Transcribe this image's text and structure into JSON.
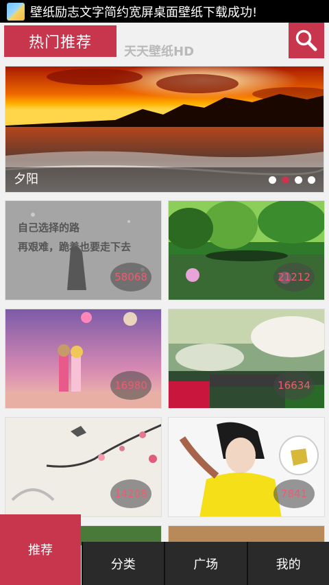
{
  "status_bar": {
    "notification": "壁纸励志文字简约宽屏桌面壁纸下载成功!"
  },
  "header": {
    "tab_label": "热门推荐",
    "app_title": "天天壁纸HD",
    "search_icon": "search-icon"
  },
  "banner": {
    "caption": "夕阳",
    "slides": 4,
    "active_slide": 2
  },
  "tiles": [
    {
      "count": "58068",
      "overlay_line1": "自己选择的路",
      "overlay_line2": "再艰难，跪着也要走下去"
    },
    {
      "count": "21212"
    },
    {
      "count": "16980"
    },
    {
      "count": "16634"
    },
    {
      "count": "14208"
    },
    {
      "count": "7841"
    }
  ],
  "bottom_nav": {
    "items": [
      "推荐",
      "分类",
      "广场",
      "我的"
    ],
    "active": 0
  },
  "colors": {
    "accent": "#c8364e",
    "nav_bg": "#2a2a2a"
  }
}
